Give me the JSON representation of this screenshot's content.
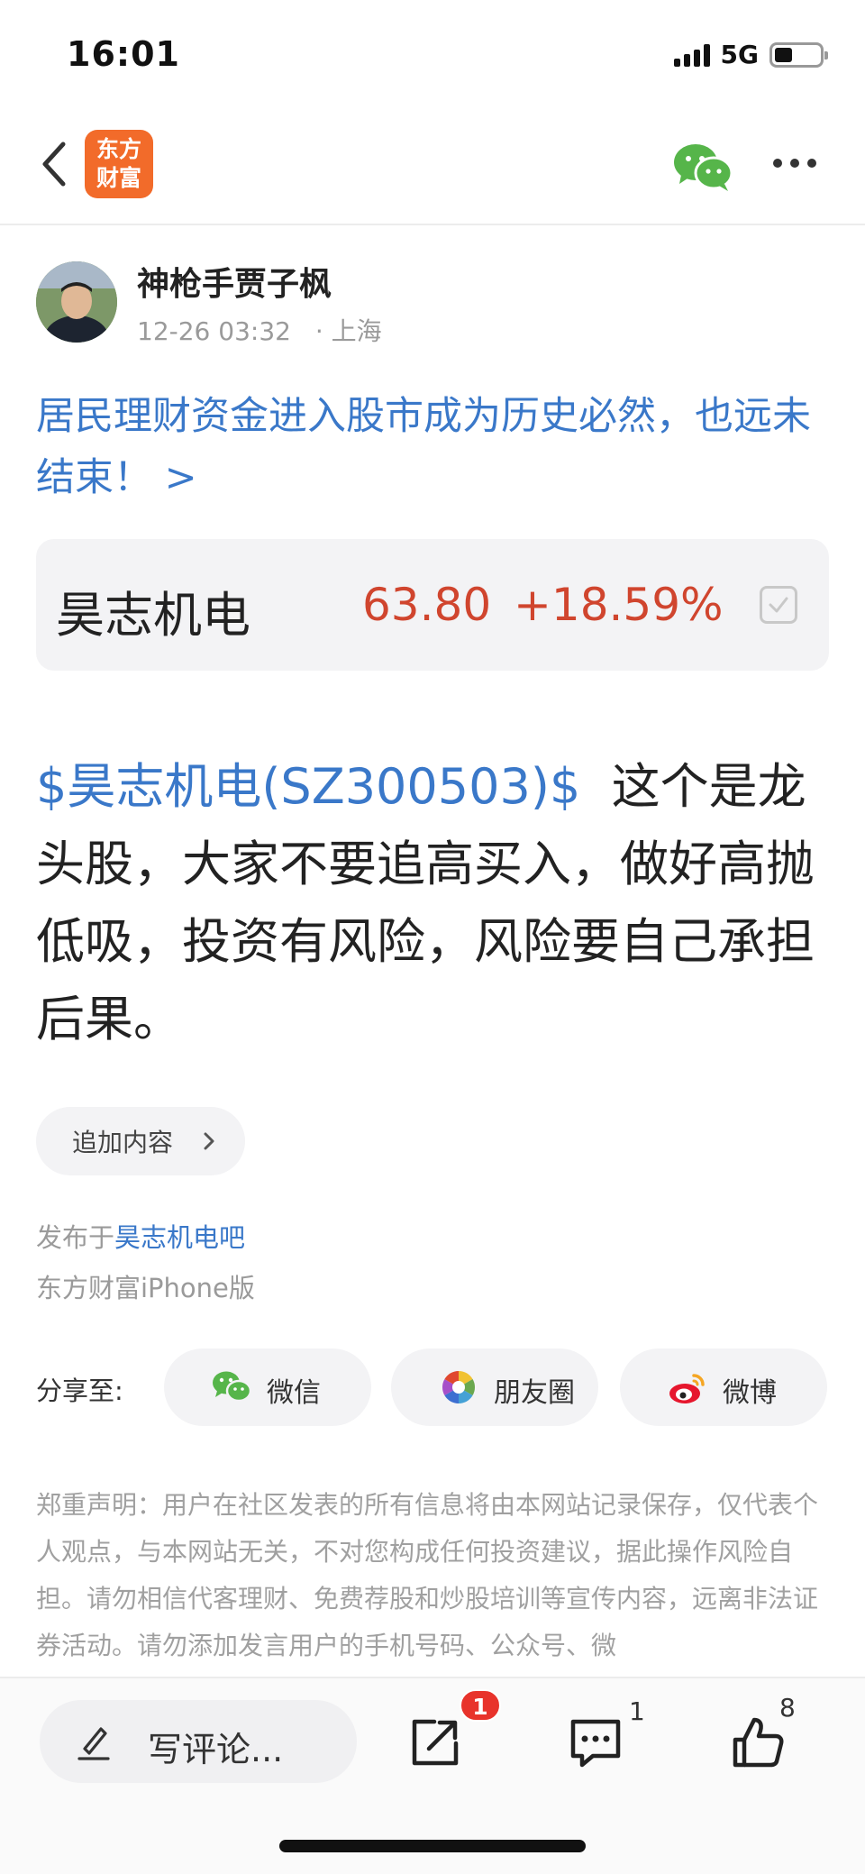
{
  "status_bar": {
    "time": "16:01",
    "network": "5G",
    "battery_level": 0.4
  },
  "nav": {
    "logo_line1": "东方",
    "logo_line2": "财富",
    "back_icon": "chevron-left-icon",
    "share_icon": "wechat-icon",
    "more_icon": "more-dots-icon"
  },
  "author": {
    "name": "神枪手贾子枫",
    "time": "12-26 03:32",
    "location": "· 上海"
  },
  "headline_link": "居民理财资金进入股市成为历史必然，也远未结束！ >",
  "quote": {
    "name": "昊志机电",
    "price": "63.80",
    "change": "+18.59%",
    "price_color": "#d0452e"
  },
  "post": {
    "tag": "$昊志机电(SZ300503)$",
    "text": "这个是龙头股，大家不要追高买入，做好高抛低吸，投资有风险，风险要自己承担后果。"
  },
  "append": {
    "label": "追加内容"
  },
  "meta": {
    "published_prefix": "发布于",
    "published_bar": "昊志机电吧",
    "platform": "东方财富iPhone版"
  },
  "share": {
    "label": "分享至:",
    "wechat": "微信",
    "moments": "朋友圈",
    "weibo": "微博"
  },
  "disclaimer": "郑重声明：用户在社区发表的所有信息将由本网站记录保存，仅代表个人观点，与本网站无关，不对您构成任何投资建议，据此操作风险自担。请勿相信代客理财、免费荐股和炒股培训等宣传内容，远离非法证券活动。请勿添加发言用户的手机号码、公众号、微",
  "bottom": {
    "comment_placeholder": "写评论...",
    "forward_badge": "1",
    "comment_count": "1",
    "like_count": "8"
  },
  "colors": {
    "link": "#3a78c9",
    "up": "#d0452e",
    "brand": "#f26b2a",
    "badge": "#e8332b"
  }
}
